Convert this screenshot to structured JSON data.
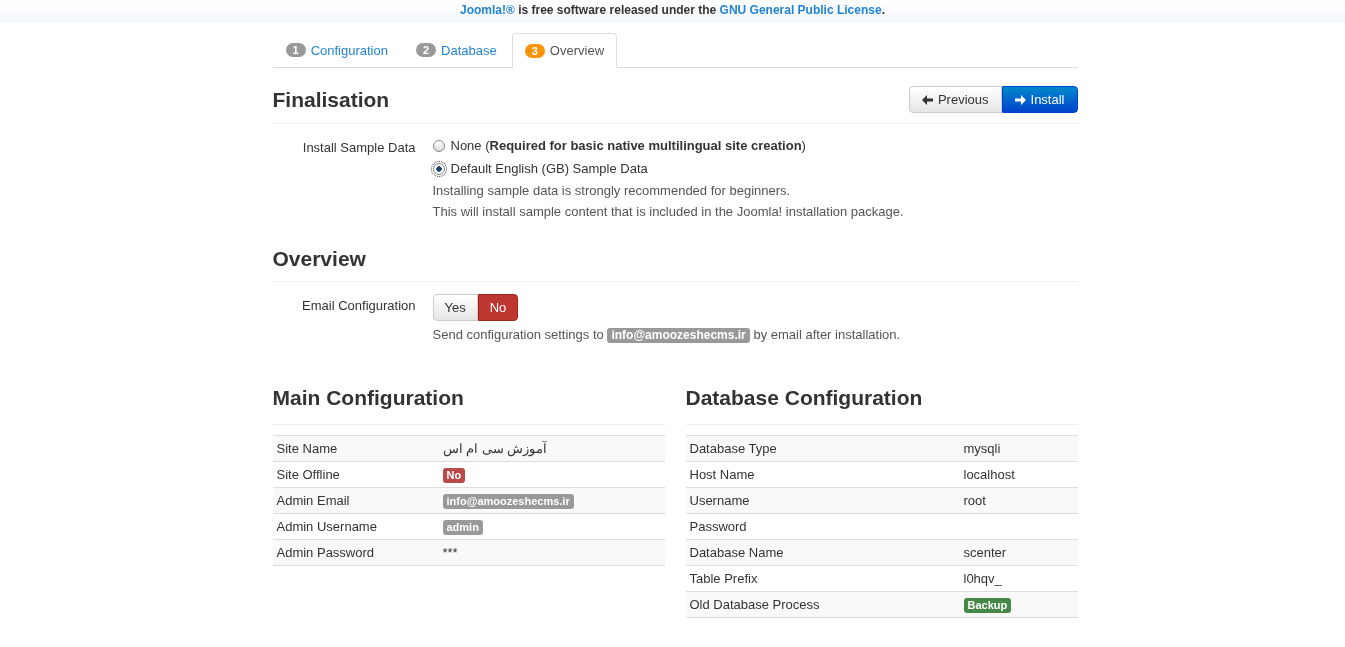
{
  "footer": {
    "link_1": "Joomla!®",
    "text": " is free software released under the ",
    "link_2": "GNU General Public License",
    "end": "."
  },
  "tabs": [
    {
      "number": "1",
      "label": "Configuration",
      "selected": false
    },
    {
      "number": "2",
      "label": "Database",
      "selected": false
    },
    {
      "number": "3",
      "label": "Overview",
      "selected": true
    }
  ],
  "finalisation": {
    "title": "Finalisation",
    "buttons": [
      {
        "label": "Previous",
        "kind": "default"
      },
      {
        "label": "Install",
        "kind": "primary"
      }
    ],
    "field_label": "Install Sample Data",
    "options": [
      {
        "label": "None (**Required for basic native multilingual site creation**)",
        "selected": false
      },
      {
        "label": "Default English (GB) Sample Data",
        "selected": true
      }
    ],
    "help": [
      "Installing sample data is strongly recommended for beginners.",
      "This will install sample content that is included in the Joomla! installation package."
    ]
  },
  "overview": {
    "title": "Overview",
    "field_label": "Email Configuration",
    "toggle": [
      {
        "label": "Yes",
        "selected": false
      },
      {
        "label": "No",
        "selected": true
      }
    ],
    "help_before": "Send configuration settings to ",
    "help_email": "info@amoozeshecms.ir",
    "help_after": " by email after installation."
  },
  "main_config": {
    "title": "Main Configuration",
    "rows": [
      {
        "label": "Site Name",
        "value": "آموزش سی ام اس",
        "kind": "text"
      },
      {
        "label": "Site Offline",
        "value": "No",
        "kind": "badge",
        "color": "#b94a48"
      },
      {
        "label": "Admin Email",
        "value": "info@amoozeshecms.ir",
        "kind": "badge",
        "color": "#999999"
      },
      {
        "label": "Admin Username",
        "value": "admin",
        "kind": "badge",
        "color": "#999999"
      },
      {
        "label": "Admin Password",
        "value": "***",
        "kind": "text"
      }
    ]
  },
  "db_config": {
    "title": "Database Configuration",
    "rows": [
      {
        "label": "Database Type",
        "value": "mysqli",
        "kind": "text"
      },
      {
        "label": "Host Name",
        "value": "localhost",
        "kind": "text"
      },
      {
        "label": "Username",
        "value": "root",
        "kind": "text"
      },
      {
        "label": "Password",
        "value": "",
        "kind": "text"
      },
      {
        "label": "Database Name",
        "value": "scenter",
        "kind": "text"
      },
      {
        "label": "Table Prefix",
        "value": "l0hqv_",
        "kind": "text"
      },
      {
        "label": "Old Database Process",
        "value": "Backup",
        "kind": "badge",
        "color": "#468847"
      }
    ]
  }
}
